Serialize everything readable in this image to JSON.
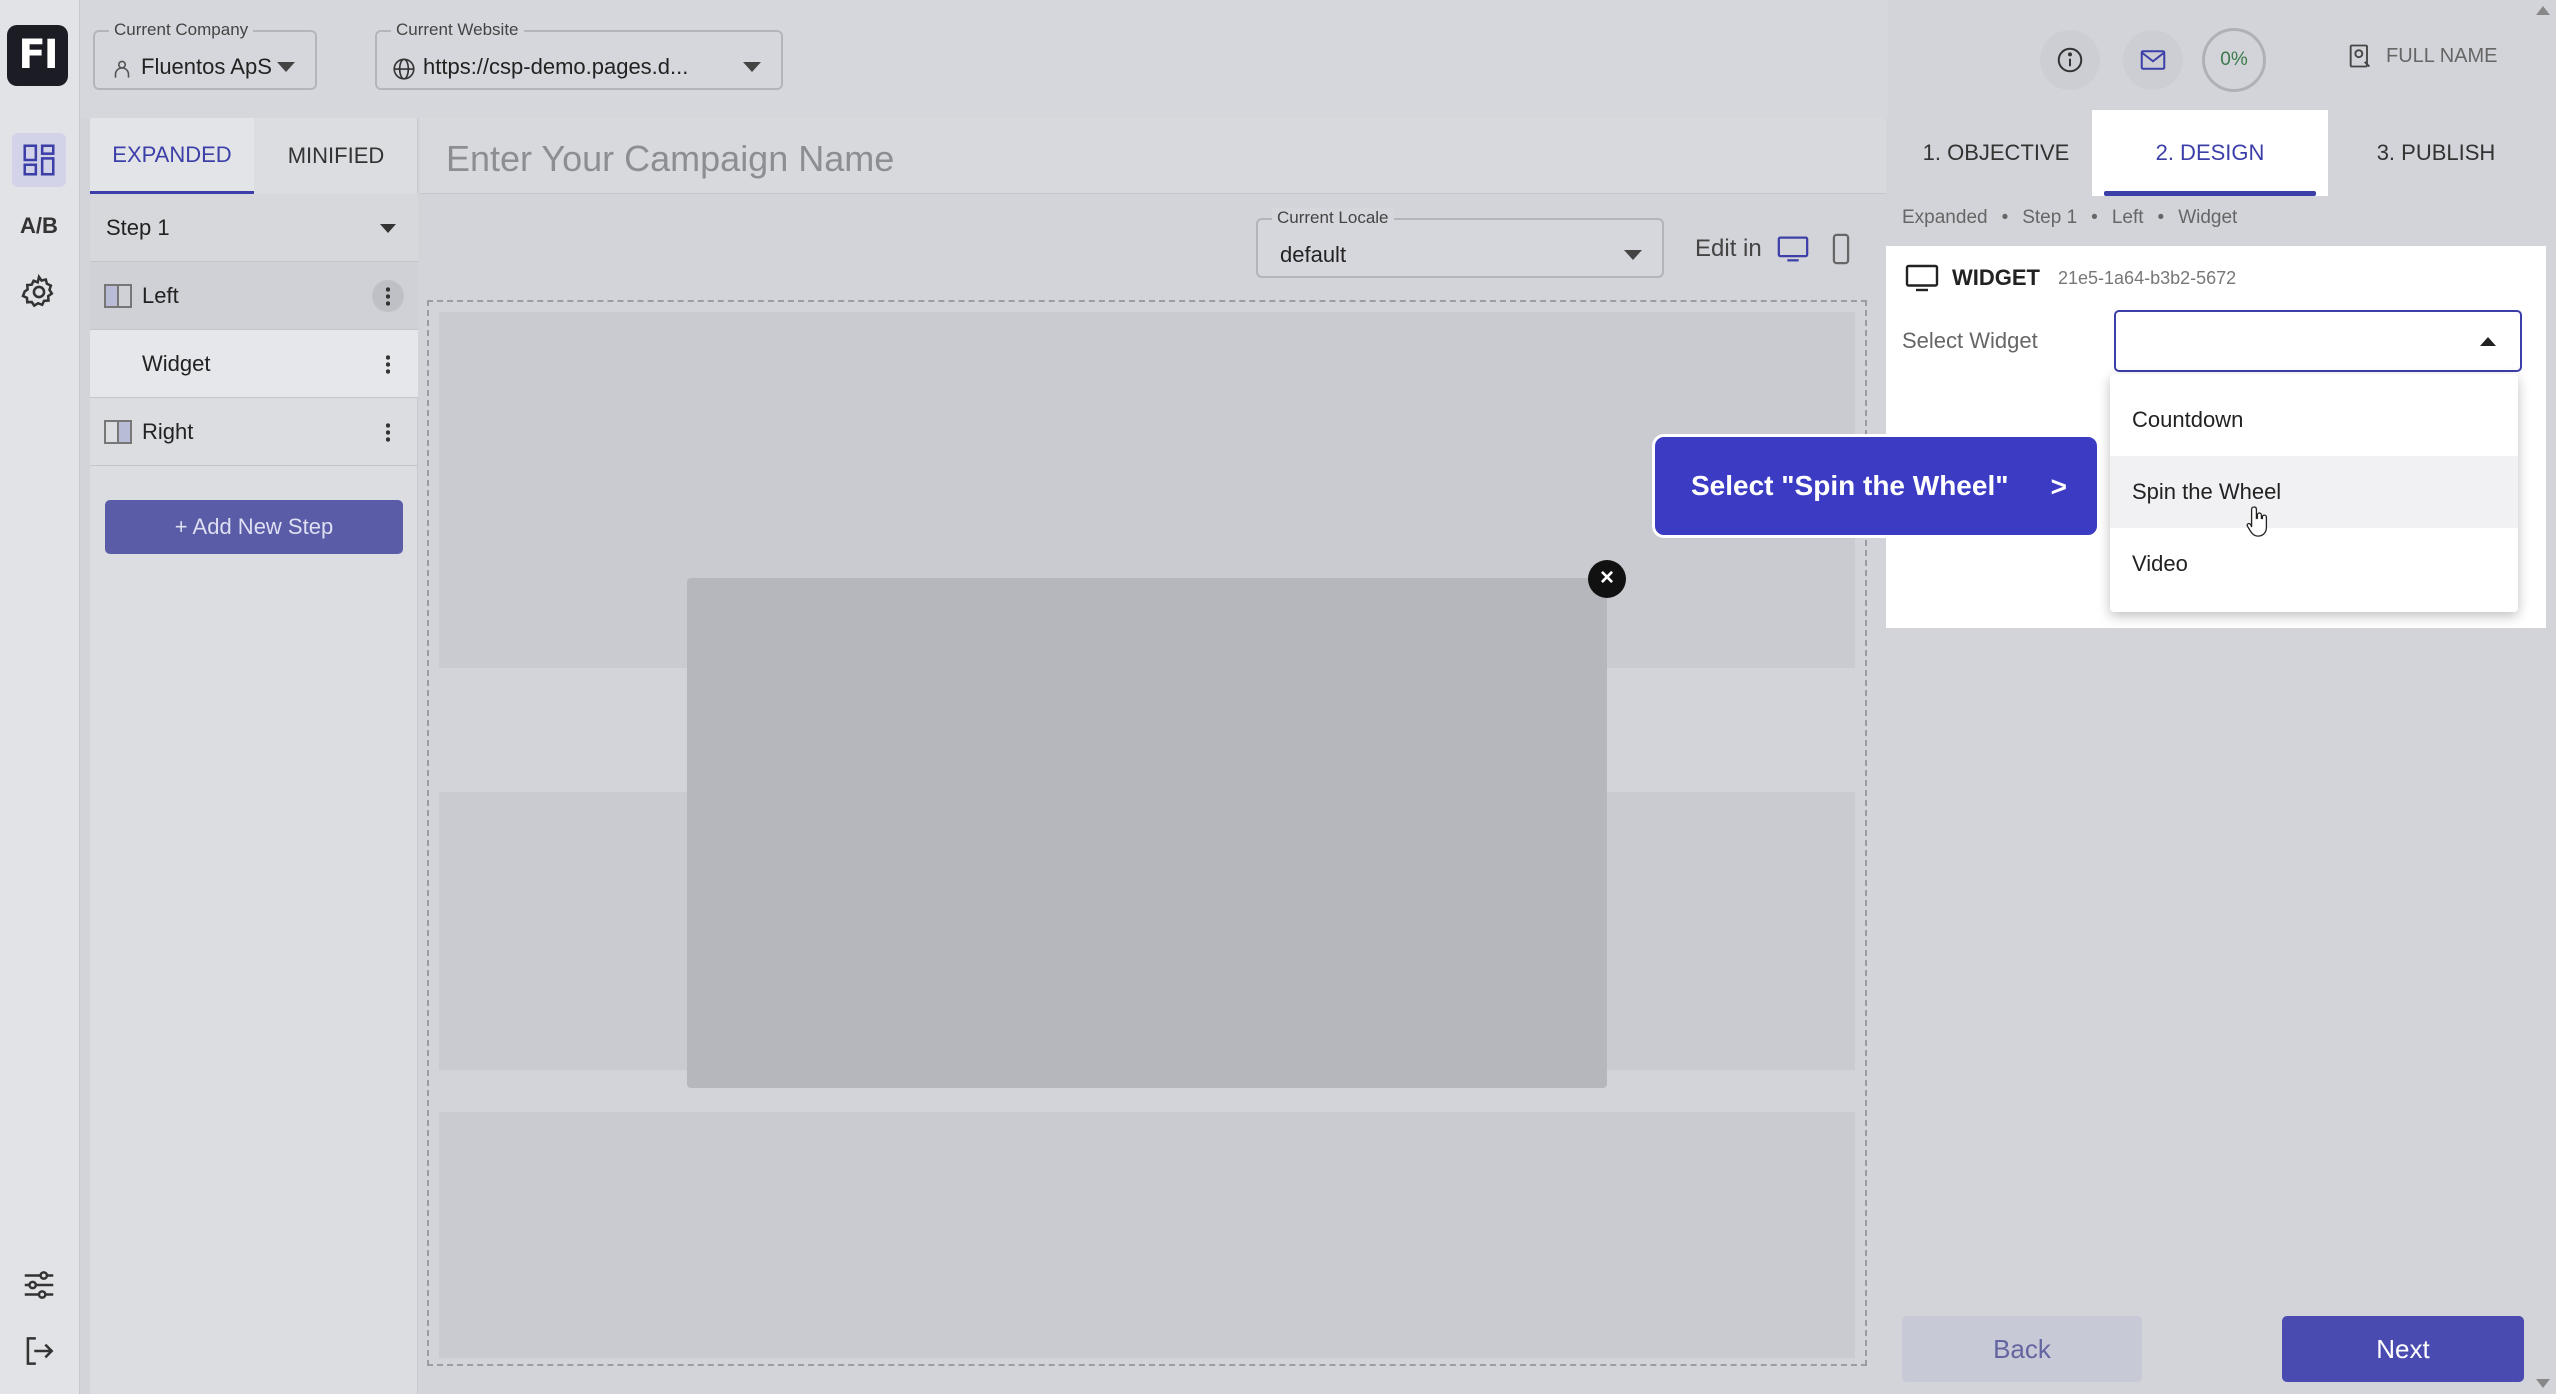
{
  "rail": {
    "logo": "FI",
    "ab_label": "A/B"
  },
  "topbar": {
    "company": {
      "label": "Current Company",
      "value": "Fluentos ApS"
    },
    "website": {
      "label": "Current Website",
      "value": "https://csp-demo.pages.d..."
    },
    "progress": "0%",
    "user": "FULL NAME"
  },
  "steps": {
    "tabs": [
      {
        "label": "EXPANDED"
      },
      {
        "label": "MINIFIED"
      }
    ],
    "step_select": "Step 1",
    "items": [
      {
        "label": "Left"
      },
      {
        "label": "Widget"
      },
      {
        "label": "Right"
      }
    ],
    "add_button": "+ Add New Step"
  },
  "campaign": {
    "placeholder": "Enter Your Campaign Name"
  },
  "locale": {
    "label": "Current Locale",
    "value": "default"
  },
  "edit_in": "Edit in",
  "wizard": {
    "tabs": [
      {
        "label": "1. OBJECTIVE"
      },
      {
        "label": "2. DESIGN"
      },
      {
        "label": "3. PUBLISH"
      }
    ],
    "breadcrumb": [
      "Expanded",
      "•",
      "Step 1",
      "•",
      "Left",
      "•",
      "Widget"
    ]
  },
  "widget": {
    "title": "WIDGET",
    "id": "21e5-1a64-b3b2-5672",
    "select_label": "Select Widget",
    "options": [
      "Countdown",
      "Spin the Wheel",
      "Video"
    ]
  },
  "tooltip": {
    "text": "Select \"Spin the Wheel\"",
    "arrow": ">"
  },
  "footer": {
    "back": "Back",
    "next": "Next"
  },
  "colors": {
    "accent": "#3d3fa8",
    "tooltip": "#3b3bc4"
  }
}
